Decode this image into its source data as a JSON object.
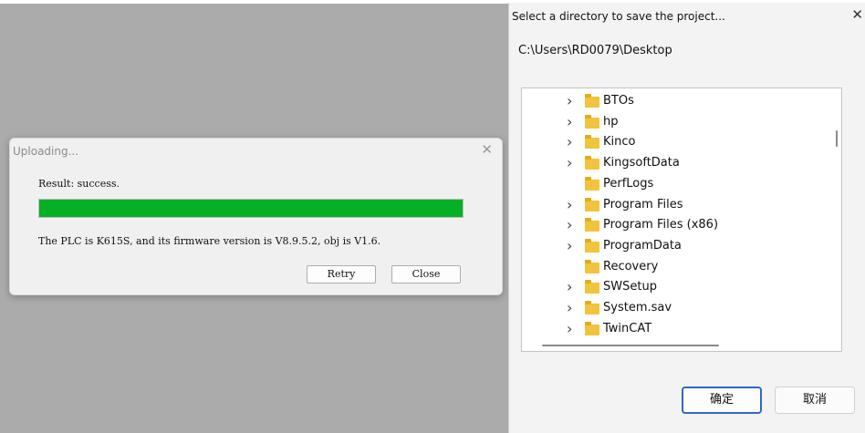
{
  "upload_dialog": {
    "title": "Uploading...",
    "result": "Result: success.",
    "progress_percent": 100,
    "progress_color": "#06b025",
    "message": "The PLC is  K615S, and its firmware version is V8.9.5.2, obj is V1.6.",
    "retry_label": "Retry",
    "close_label": "Close",
    "close_icon": "close-icon"
  },
  "directory_dialog": {
    "title": "Select a directory to save the project...",
    "path": "C:\\Users\\RD0079\\Desktop",
    "close_icon": "close-icon",
    "folders": [
      {
        "name": "BTOs",
        "expandable": true
      },
      {
        "name": "hp",
        "expandable": true
      },
      {
        "name": "Kinco",
        "expandable": true
      },
      {
        "name": "KingsoftData",
        "expandable": true
      },
      {
        "name": "PerfLogs",
        "expandable": false
      },
      {
        "name": "Program Files",
        "expandable": true
      },
      {
        "name": "Program Files (x86)",
        "expandable": true
      },
      {
        "name": "ProgramData",
        "expandable": true
      },
      {
        "name": "Recovery",
        "expandable": false
      },
      {
        "name": "SWSetup",
        "expandable": true
      },
      {
        "name": "System.sav",
        "expandable": true
      },
      {
        "name": "TwinCAT",
        "expandable": true
      }
    ],
    "ok_label": "确定",
    "cancel_label": "取消",
    "accent_color": "#2f67c9",
    "folder_color": "#f2c33c"
  }
}
